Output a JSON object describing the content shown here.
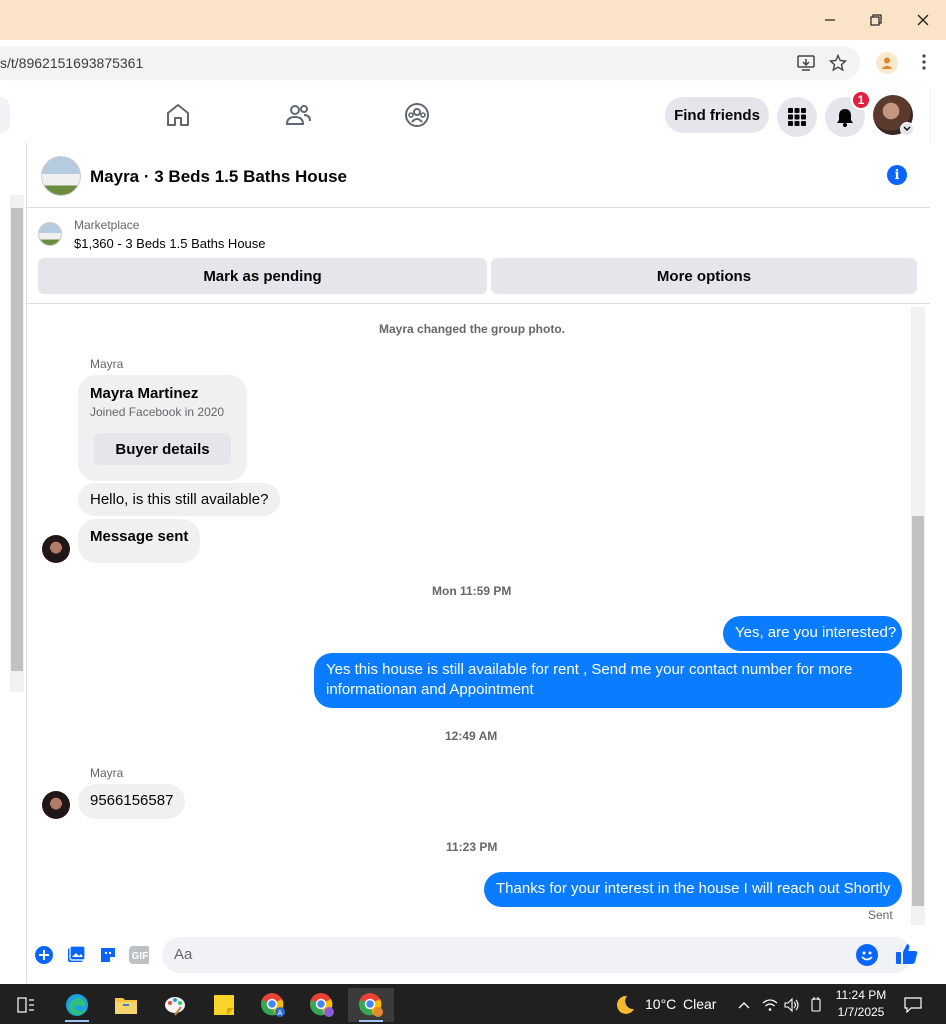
{
  "browser": {
    "url": "s/t/8962151693875361",
    "window_controls": [
      "minimize-icon",
      "restore-icon",
      "close-icon"
    ]
  },
  "fb_nav": {
    "find_friends": "Find friends",
    "notification_count": "1"
  },
  "chat": {
    "title": "Mayra · 3 Beds 1.5 Baths House",
    "marketplace_label": "Marketplace",
    "listing": "$1,360 - 3 Beds 1.5 Baths House",
    "mark_pending": "Mark as pending",
    "more_options": "More options"
  },
  "messages": {
    "group_photo_notice": "Mayra changed the group photo.",
    "sender_1": "Mayra",
    "buyer_name": "Mayra Martinez",
    "buyer_joined": "Joined Facebook in 2020",
    "buyer_details_btn": "Buyer details",
    "msg_still_available": "Hello, is this still available?",
    "msg_sent": "Message sent",
    "time_1": "Mon 11:59 PM",
    "reply_1": "Yes, are you interested?",
    "reply_2": "Yes this house is still available for rent , Send me your contact number for more informationan and Appointment",
    "time_2": "12:49 AM",
    "sender_2": "Mayra",
    "phone": "9566156587",
    "time_3": "11:23 PM",
    "reply_3": "Thanks for your interest in the house I will reach out Shortly",
    "status": "Sent"
  },
  "composer": {
    "placeholder": "Aa"
  },
  "taskbar": {
    "weather_temp": "10°C",
    "weather_cond": "Clear",
    "time": "11:24 PM",
    "date": "1/7/2025"
  },
  "colors": {
    "accent": "#0866ff",
    "outgoing_bubble": "#0a7cff",
    "badge": "#e41e3f",
    "titlebar": "#fbe3c8"
  }
}
